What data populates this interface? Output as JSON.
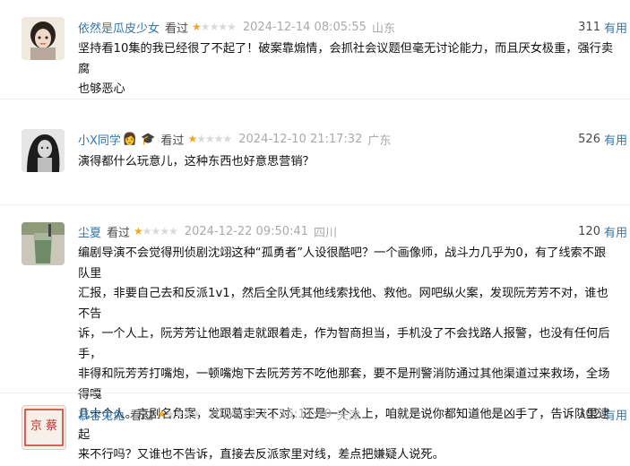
{
  "colors": {
    "link": "#3377aa",
    "star": "#f5a623",
    "meta": "#aaaaaa"
  },
  "comments": [
    {
      "user": "依然是瓜皮少女",
      "status": "看过",
      "rating": 1,
      "time": "2024-12-14 08:05:55",
      "location": "山东",
      "votes": "311",
      "vote_label": "有用",
      "lines": [
        "坚持看10集的我已经很了不起了！破案靠煽情，会抓社会议题但毫无讨论能力，而且厌女极重，强行卖腐",
        "也够恶心"
      ]
    },
    {
      "user": "小X同学",
      "status": "看过",
      "rating": 1,
      "time": "2024-12-10 21:17:32",
      "location": "广东",
      "votes": "526",
      "vote_label": "有用",
      "emoji": "👩 🎓",
      "lines": [
        "演得都什么玩意儿，这种东西也好意思营销？"
      ]
    },
    {
      "user": "尘夏",
      "status": "看过",
      "rating": 1,
      "time": "2024-12-22 09:50:41",
      "location": "四川",
      "votes": "120",
      "vote_label": "有用",
      "lines": [
        "编剧导演不会觉得刑侦剧沈翊这种“孤勇者”人设很酷吧？一个画像师，战斗力几乎为0，有了线索不跟队里",
        "汇报，非要自己去和反派1v1，然后全队凭其他线索找他、救他。网吧纵火案，发现阮芳芳不对，谁也不告",
        "诉，一个人上，阮芳芳让他跟着走就跟着走，作为智商担当，手机没了不会找路人报警，也没有任何后手，",
        "非得和阮芳芳打嘴炮，一顿嘴炮下去阮芳芳不吃他那套，要不是刑警消防通过其他渠道过来救场，全场得嘎",
        "几十个人。京剧名角案，发现葛宇天不对，还是一个人上，咱就是说你都知道他是凶手了，告诉队里逮起",
        "来不行吗？又谁也不告诉，直接去反派家里对线，差点把嫌疑人说死。"
      ]
    },
    {
      "user": "慕容兔兔",
      "status": "看过",
      "rating": 1,
      "time": "2024-12-11 15:11:10",
      "location": "天津",
      "votes": "302",
      "vote_label": "有用",
      "avatar_text": "京 蔡",
      "lines": []
    }
  ]
}
